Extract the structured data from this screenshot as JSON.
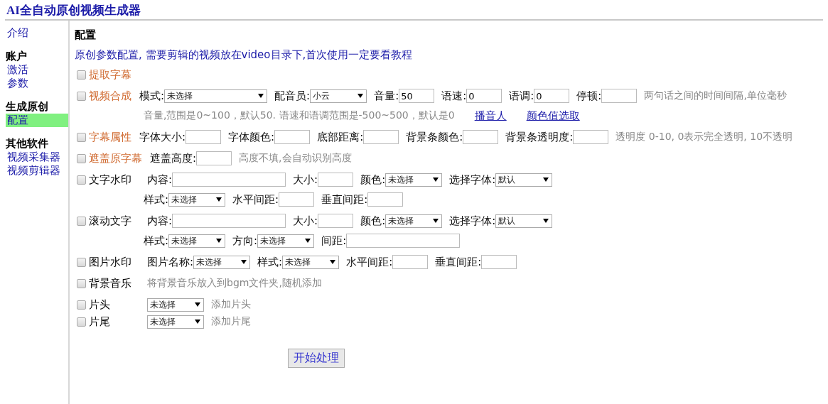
{
  "header": {
    "title": "AI全自动原创视频生成器"
  },
  "sidebar": {
    "groups": [
      {
        "items": [
          {
            "label": "介绍",
            "selected": false
          }
        ]
      },
      {
        "heading": "账户",
        "items": [
          {
            "label": "激活",
            "selected": false
          },
          {
            "label": "参数",
            "selected": false
          }
        ]
      },
      {
        "heading": "生成原创",
        "items": [
          {
            "label": "配置",
            "selected": true
          }
        ]
      },
      {
        "heading": "其他软件",
        "items": [
          {
            "label": "视频采集器",
            "selected": false
          },
          {
            "label": "视频剪辑器",
            "selected": false
          }
        ]
      }
    ]
  },
  "main": {
    "title": "配置",
    "intro": "原创参数配置, 需要剪辑的视频放在video目录下,首次使用一定要看教程",
    "option_groups": [
      [
        {
          "checked": false,
          "title": "提取字幕",
          "help_link": true
        }
      ],
      [
        {
          "checked": false,
          "title": "视频合成",
          "help_link": true,
          "lines": [
            [
              {
                "kind": "wide_select",
                "label": "模式:",
                "value": "未选择"
              },
              {
                "kind": "select",
                "label": "配音员:",
                "value": "小云"
              },
              {
                "kind": "input",
                "label": "音量:",
                "value": "50"
              },
              {
                "kind": "input",
                "label": "语速:",
                "value": "0"
              },
              {
                "kind": "input",
                "label": "语调:",
                "value": "0"
              },
              {
                "kind": "input",
                "label": "停顿:"
              },
              {
                "kind": "note",
                "text": "两句话之间的时间间隔,单位毫秒"
              }
            ],
            [
              {
                "kind": "note",
                "text": "音量,范围是0~100，默认50. 语速和语调范围是-500~500，默认是0"
              },
              {
                "kind": "link",
                "text": "播音人"
              },
              {
                "kind": "link",
                "text": "颜色值选取"
              }
            ]
          ]
        }
      ],
      [
        {
          "checked": false,
          "title": "字幕属性",
          "help_link": true,
          "lines": [
            [
              {
                "kind": "input",
                "label": "字体大小:"
              },
              {
                "kind": "input",
                "label": "字体颜色:"
              },
              {
                "kind": "input",
                "label": "底部距离:"
              },
              {
                "kind": "input",
                "label": "背景条颜色:"
              },
              {
                "kind": "input",
                "label": "背景条透明度:"
              },
              {
                "kind": "note",
                "text": "透明度 0-10, 0表示完全透明, 10不透明"
              }
            ]
          ]
        }
      ],
      [
        {
          "checked": false,
          "title": "遮盖原字幕",
          "help_link": true,
          "lines": [
            [
              {
                "kind": "input",
                "label": "遮盖高度:"
              },
              {
                "kind": "note",
                "text": "高度不填,会自动识别高度"
              }
            ]
          ]
        }
      ],
      [
        {
          "checked": false,
          "title": "文字水印",
          "help_link": false,
          "lines": [
            [
              {
                "kind": "wide_input",
                "label": "内容:"
              },
              {
                "kind": "input",
                "label": "大小:"
              },
              {
                "kind": "select",
                "label": "颜色:",
                "value": "未选择"
              },
              {
                "kind": "select",
                "label": "选择字体:",
                "value": "默认"
              }
            ],
            [
              {
                "kind": "select",
                "label": "样式:",
                "value": "未选择"
              },
              {
                "kind": "input",
                "label": "水平间距:"
              },
              {
                "kind": "input",
                "label": "垂直间距:"
              }
            ]
          ]
        }
      ],
      [
        {
          "checked": false,
          "title": "滚动文字",
          "help_link": false,
          "lines": [
            [
              {
                "kind": "wide_input",
                "label": "内容:"
              },
              {
                "kind": "input",
                "label": "大小:"
              },
              {
                "kind": "select",
                "label": "颜色:",
                "value": "未选择"
              },
              {
                "kind": "select",
                "label": "选择字体:",
                "value": "默认"
              }
            ],
            [
              {
                "kind": "select",
                "label": "样式:",
                "value": "未选择"
              },
              {
                "kind": "select",
                "label": "方向:",
                "value": "未选择"
              },
              {
                "kind": "wide_input",
                "label": "间距:"
              }
            ]
          ]
        }
      ],
      [
        {
          "checked": false,
          "title": "图片水印",
          "help_link": false,
          "lines": [
            [
              {
                "kind": "select",
                "label": "图片名称:",
                "value": "未选择"
              },
              {
                "kind": "select",
                "label": "样式:",
                "value": "未选择"
              },
              {
                "kind": "input",
                "label": "水平间距:"
              },
              {
                "kind": "input",
                "label": "垂直间距:"
              }
            ]
          ]
        }
      ],
      [
        {
          "checked": false,
          "title": "背景音乐",
          "help_link": false,
          "lines": [
            [
              {
                "kind": "note",
                "text": "将背景音乐放入到bgm文件夹,随机添加"
              }
            ]
          ]
        }
      ],
      [
        {
          "checked": false,
          "title": "片头",
          "help_link": false,
          "lines": [
            [
              {
                "kind": "select",
                "value": "未选择"
              },
              {
                "kind": "note",
                "text": "添加片头"
              }
            ]
          ]
        },
        {
          "checked": false,
          "title": "片尾",
          "help_link": false,
          "lines": [
            [
              {
                "kind": "select",
                "value": "未选择"
              },
              {
                "kind": "note",
                "text": "添加片尾"
              }
            ]
          ]
        }
      ]
    ],
    "submit": "开始处理"
  }
}
